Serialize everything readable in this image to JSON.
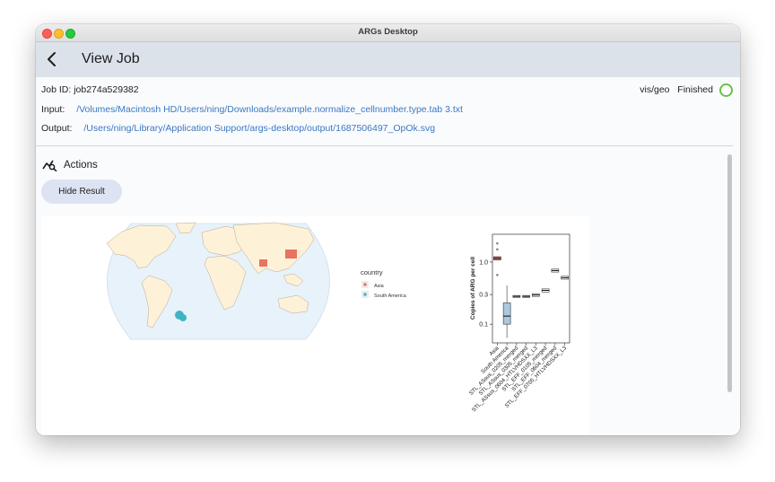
{
  "window": {
    "title": "ARGs Desktop"
  },
  "appbar": {
    "title": "View Job"
  },
  "job": {
    "id_label": "Job ID:",
    "id_value": "job274a529382",
    "input_label": "Input:",
    "input_value": "/Volumes/Macintosh HD/Users/ning/Downloads/example.normalize_cellnumber.type.tab 3.txt",
    "output_label": "Output:",
    "output_value": "/Users/ning/Library/Application Support/args-desktop/output/1687506497_OpOk.svg",
    "mode": "vis/geo",
    "status": "Finished"
  },
  "actions": {
    "title": "Actions",
    "hide_button": "Hide Result"
  },
  "map_legend": {
    "title": "country",
    "items": [
      {
        "label": "Asia",
        "color": "#e8735f"
      },
      {
        "label": "South America",
        "color": "#3fb3c4"
      }
    ]
  },
  "chart_data": {
    "type": "boxplot",
    "ylabel": "Copies of ARG per cell",
    "yscale": "log",
    "yticks": [
      "1.0",
      "0.3",
      "0.1"
    ],
    "ytick_values": [
      1.0,
      0.3,
      0.1
    ],
    "ylim": [
      0.05,
      2.8
    ],
    "categories": [
      "Asia",
      "South America",
      "STL_ASsus_0205_merged",
      "STL_ASsus_0305_merged",
      "STL_ASsus_0604_HTLVHDSXX_L3",
      "STL_EFF_0105_merged",
      "STL_EFF_0604_merged",
      "STL_EFF_0705_HTLVHDSXX_L3"
    ],
    "boxes": [
      {
        "category": "Asia",
        "q1": 1.08,
        "median": 1.15,
        "q3": 1.22,
        "lo": 1.08,
        "hi": 1.22,
        "fill": "#e8735f",
        "outliers": [
          2.0,
          1.6,
          0.62
        ]
      },
      {
        "category": "South America",
        "q1": 0.1,
        "median": 0.135,
        "q3": 0.22,
        "lo": 0.06,
        "hi": 0.42,
        "fill": "#a9c8e2",
        "outliers": []
      },
      {
        "category": "STL_ASsus_0205_merged",
        "q1": 0.27,
        "median": 0.28,
        "q3": 0.29,
        "lo": 0.27,
        "hi": 0.29,
        "fill": "#ffffff",
        "outliers": []
      },
      {
        "category": "STL_ASsus_0305_merged",
        "q1": 0.27,
        "median": 0.28,
        "q3": 0.29,
        "lo": 0.27,
        "hi": 0.29,
        "fill": "#ffffff",
        "outliers": []
      },
      {
        "category": "STL_ASsus_0604_HTLVHDSXX_L3",
        "q1": 0.28,
        "median": 0.295,
        "q3": 0.31,
        "lo": 0.28,
        "hi": 0.31,
        "fill": "#ffffff",
        "outliers": []
      },
      {
        "category": "STL_EFF_0105_merged",
        "q1": 0.33,
        "median": 0.35,
        "q3": 0.37,
        "lo": 0.33,
        "hi": 0.37,
        "fill": "#ffffff",
        "outliers": []
      },
      {
        "category": "STL_EFF_0604_merged",
        "q1": 0.69,
        "median": 0.73,
        "q3": 0.77,
        "lo": 0.69,
        "hi": 0.77,
        "fill": "#ffffff",
        "outliers": []
      },
      {
        "category": "STL_EFF_0705_HTLVHDSXX_L3",
        "q1": 0.53,
        "median": 0.56,
        "q3": 0.59,
        "lo": 0.53,
        "hi": 0.59,
        "fill": "#ffffff",
        "outliers": []
      }
    ]
  }
}
